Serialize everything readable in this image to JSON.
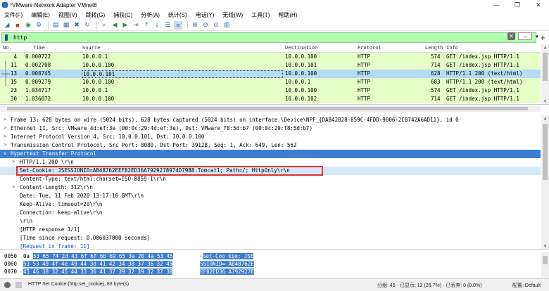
{
  "window": {
    "title": "*VMware Network Adapter VMnet8",
    "controls": {
      "minimize": "—",
      "restore": "❐",
      "close": "✕"
    }
  },
  "menu": [
    "文件(F)",
    "编辑(E)",
    "视图(V)",
    "跳转(G)",
    "捕获(C)",
    "分析(A)",
    "统计(S)",
    "电话(Y)",
    "无线(W)",
    "工具(T)",
    "帮助(H)"
  ],
  "toolbar": {
    "icons": [
      "shark-fin-icon",
      "stop-icon",
      "restart-icon",
      "options-gear-icon",
      "open-folder-icon",
      "save-icon",
      "close-file-icon",
      "reload-icon",
      "find-icon",
      "back-arrow-icon",
      "forward-arrow-icon",
      "go-to-packet-icon",
      "first-packet-icon",
      "last-packet-icon",
      "autoscroll-icon",
      "colorize-icon",
      "zoom-in-icon",
      "zoom-out-icon",
      "zoom-normal-icon",
      "resize-columns-icon"
    ]
  },
  "filter": {
    "value": "http",
    "apply_label": "→"
  },
  "packet_list": {
    "columns": [
      "No.",
      "Time",
      "Source",
      "Destination",
      "Protocol",
      "Length",
      "Info"
    ],
    "rows": [
      {
        "no": "4",
        "time": "0.000722",
        "source": "10.0.0.1",
        "destination": "10.0.0.100",
        "protocol": "HTTP",
        "length": "574",
        "info": "GET /index.jsp HTTP/1.1"
      },
      {
        "no": "11",
        "time": "0.002708",
        "source": "10.0.0.100",
        "destination": "10.0.0.101",
        "protocol": "HTTP",
        "length": "714",
        "info": "GET /index.jsp HTTP/1.1"
      },
      {
        "no": "13",
        "time": "0.008745",
        "source": "10.0.0.101",
        "destination": "10.0.0.100",
        "protocol": "HTTP",
        "length": "628",
        "info": "HTTP/1.1 200   (text/html)"
      },
      {
        "no": "15",
        "time": "0.009279",
        "source": "10.0.0.100",
        "destination": "10.0.0.1",
        "protocol": "HTTP",
        "length": "683",
        "info": "HTTP/1.1 200   (text/html)"
      },
      {
        "no": "23",
        "time": "1.034717",
        "source": "10.0.0.1",
        "destination": "10.0.0.100",
        "protocol": "HTTP",
        "length": "574",
        "info": "GET /index.jsp HTTP/1.1"
      },
      {
        "no": "30",
        "time": "1.036072",
        "source": "10.0.0.100",
        "destination": "10.0.0.102",
        "protocol": "HTTP",
        "length": "714",
        "info": "GET /index.jsp HTTP/1.1"
      }
    ],
    "selected_index": 2
  },
  "details": [
    {
      "arrow": ">",
      "text": "Frame 13: 628 bytes on wire (5024 bits), 628 bytes captured (5024 bits) on interface \\Device\\NPF_{DAB42B28-859C-4FDD-9006-2CB742A6AD11}, id 0"
    },
    {
      "arrow": ">",
      "text": "Ethernet II, Src: VMware_4d:ef:3e (00:0c:29:4d:ef:3e), Dst: VMware_f8:5d:b7 (00:0c:29:f8:5d:b7)"
    },
    {
      "arrow": ">",
      "text": "Internet Protocol Version 4, Src: 10.0.0.101, Dst: 10.0.0.100"
    },
    {
      "arrow": ">",
      "text": "Transmission Control Protocol, Src Port: 8080, Dst Port: 39128, Seq: 1, Ack: 649, Len: 562"
    },
    {
      "arrow": "v",
      "text": "Hypertext Transfer Protocol"
    },
    {
      "arrow": ">",
      "text": "HTTP/1.1 200 \\r\\n"
    },
    {
      "arrow": "",
      "text": "Set-Cookie: JSESSIONID=AB48762EEF82ED36A7929278974D79B8.Tomcat1; Path=/; HttpOnly\\r\\n"
    },
    {
      "arrow": "",
      "text": "Content-Type: text/html;charset=ISO-8859-1\\r\\n"
    },
    {
      "arrow": ">",
      "text": "Content-Length: 312\\r\\n"
    },
    {
      "arrow": "",
      "text": "Date: Tue, 11 Feb 2020 13:17:10 GMT\\r\\n"
    },
    {
      "arrow": "",
      "text": "Keep-Alive: timeout=20\\r\\n"
    },
    {
      "arrow": "",
      "text": "Connection: keep-alive\\r\\n"
    },
    {
      "arrow": "",
      "text": "\\r\\n"
    },
    {
      "arrow": "",
      "text": "[HTTP response 1/1]"
    },
    {
      "arrow": "",
      "text": "[Time since request: 0.006037000 seconds]"
    },
    {
      "arrow": "",
      "text": "[Request in frame: 11]"
    }
  ],
  "bytes": [
    {
      "offset": "0050",
      "pre": "0a",
      "hex": "53 65 74 2d 43 6f 6f 6b 69 65 3a 20 4a 53 45",
      "ascii_pre": "·",
      "ascii": "Set-Coo kie: JSE"
    },
    {
      "offset": "0060",
      "pre": "",
      "hex": "53 53 49 4f 4e 49 44 3d 41 42 34 38 37 36 32 45",
      "ascii_pre": "",
      "ascii": "SSIONID= AB48762E"
    },
    {
      "offset": "0070",
      "pre": "",
      "hex": "45 46 38 32 45 44 33 36 41 37 39 32 39 32 37 38",
      "ascii_pre": "",
      "ascii": "EF82ED36 A7929278"
    }
  ],
  "status": {
    "field_text": "HTTP Set Cookie (http.set_cookie), 83 byte(s)",
    "packets": "分组: 45 · 已显示: 12 (26.7%) · 已丢弃: 0 (0.0%)",
    "profile": "配置: Default"
  }
}
